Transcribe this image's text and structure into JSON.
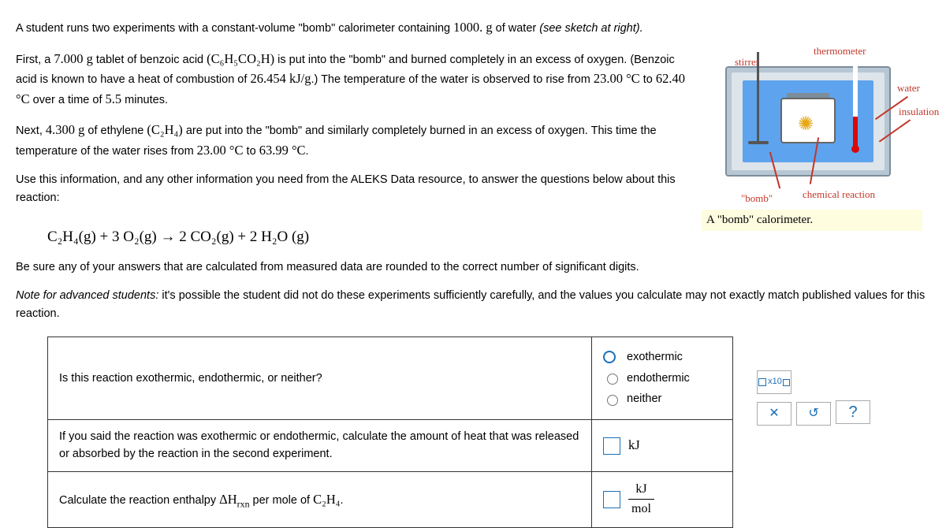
{
  "para": {
    "p1a": "A student runs two experiments with a constant-volume \"bomb\" calorimeter containing ",
    "p1_mass_water": "1000. g",
    "p1b": " of water ",
    "p1c": "(see sketch at right).",
    "p2a": "First, a ",
    "p2_mass_ba": "7.000 g",
    "p2b": " tablet of benzoic acid ",
    "p2_formula_ba": "(C₆H₅CO₂H)",
    "p2c": " is put into the \"bomb\" and burned completely in an excess of oxygen. (Benzoic acid is known to have a heat of combustion of ",
    "p2_hcomb": "26.454 kJ/g",
    "p2d": ".) The temperature of the water is observed to rise from ",
    "p2_t1": "23.00 °C",
    "p2e": " to ",
    "p2_t2": "62.40 °C",
    "p2f": " over a time of ",
    "p2_time": "5.5",
    "p2g": " minutes.",
    "p3a": "Next, ",
    "p3_mass_eth": "4.300 g",
    "p3b": " of ethylene ",
    "p3_formula_eth": "(C₂H₄)",
    "p3c": " are put into the \"bomb\" and similarly completely burned in an excess of oxygen. This time the temperature of the water rises from ",
    "p3_t1": "23.00 °C",
    "p3d": " to ",
    "p3_t2": "63.99 °C",
    "p3e": ".",
    "p4": "Use this information, and any other information you need from the ALEKS Data resource, to answer the questions below about this reaction:",
    "equation": "C₂H₄(g) + 3 O₂(g)  →  2 CO₂(g) + 2 H₂O (g)",
    "p5": "Be sure any of your answers that are calculated from measured data are rounded to the correct number of significant digits.",
    "p6a": "Note for advanced students:",
    "p6b": " it's possible the student did not do these experiments sufficiently carefully, and the values you calculate may not exactly match published values for this reaction."
  },
  "diagram": {
    "stirrer": "stirrer",
    "thermometer": "thermometer",
    "water": "water",
    "insulation": "insulation",
    "bomb": "\"bomb\"",
    "chemical_reaction": "chemical reaction",
    "caption": "A \"bomb\" calorimeter."
  },
  "table": {
    "q1": "Is this reaction exothermic, endothermic, or neither?",
    "opt_exo": "exothermic",
    "opt_endo": "endothermic",
    "opt_neither": "neither",
    "q2": "If you said the reaction was exothermic or endothermic, calculate the amount of heat that was released or absorbed by the reaction in the second experiment.",
    "q2_unit": "kJ",
    "q3a": "Calculate the reaction enthalpy ",
    "q3_dH": "ΔH",
    "q3_sub": "rxn",
    "q3b": " per mole of ",
    "q3_formula": "C₂H₄",
    "q3c": ".",
    "q3_unit_top": "kJ",
    "q3_unit_bot": "mol"
  },
  "helper": {
    "x10": "x10",
    "x": "✕",
    "reset": "↺",
    "help": "?"
  }
}
